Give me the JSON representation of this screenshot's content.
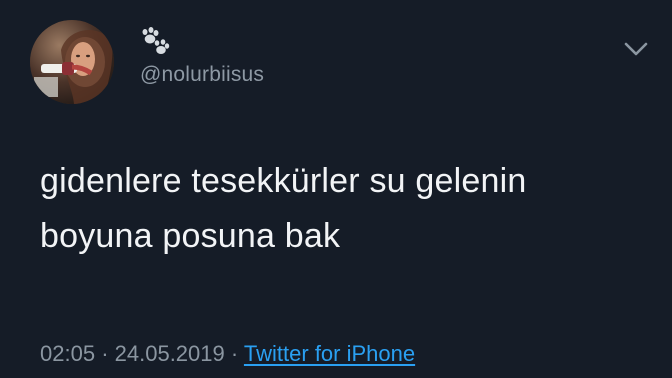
{
  "tweet": {
    "handle": "@nolurbiisus",
    "text_line_1": "gidenlere tesekkürler su gelenin",
    "text_line_2": "boyuna posuna bak",
    "time": "02:05",
    "separator_1": "·",
    "date": "24.05.2019",
    "separator_2": "·",
    "source": "Twitter for iPhone"
  },
  "icons": {
    "name_icon": "paw-prints-icon",
    "menu_icon": "chevron-down-icon"
  },
  "colors": {
    "background": "#151c27",
    "text": "#f2f4f6",
    "secondary": "#8b96a1",
    "link": "#2aa0f2"
  }
}
